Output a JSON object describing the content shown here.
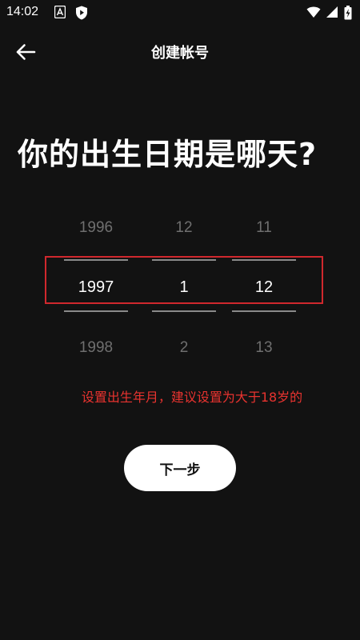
{
  "status_bar": {
    "time": "14:02",
    "icons": [
      "a-notification-icon",
      "shield-play-icon",
      "wifi-icon",
      "signal-icon",
      "battery-charging-icon"
    ]
  },
  "header": {
    "title": "创建帐号",
    "back_icon": "arrow-left-icon"
  },
  "question": "你的出生日期是哪天?",
  "picker": {
    "year": {
      "prev": "1996",
      "selected": "1997",
      "next": "1998"
    },
    "month": {
      "prev": "12",
      "selected": "1",
      "next": "2"
    },
    "day": {
      "prev": "11",
      "selected": "12",
      "next": "13"
    }
  },
  "hint": "设置出生年月，建议设置为大于18岁的",
  "next_button": "下一步",
  "colors": {
    "background": "#121212",
    "highlight_border": "#d0282d",
    "hint_text": "#e8332f",
    "button_bg": "#ffffff"
  }
}
